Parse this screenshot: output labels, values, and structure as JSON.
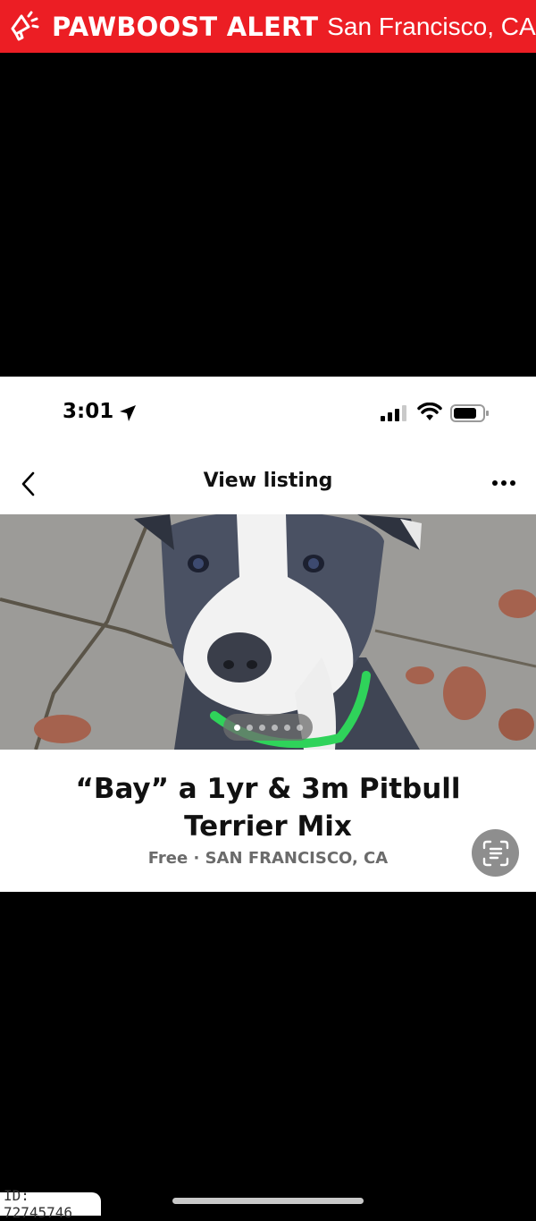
{
  "banner": {
    "brand": "PAWBOOST ALERT",
    "location": "San Francisco, CA",
    "color": "#ec1e24",
    "icon": "megaphone-icon"
  },
  "status_bar": {
    "time": "3:01",
    "icons": [
      "location-arrow-icon",
      "cellular-signal-icon",
      "wifi-icon",
      "battery-icon"
    ]
  },
  "nav": {
    "title": "View listing",
    "back_icon": "chevron-left-icon",
    "more_icon": "more-dots-icon"
  },
  "listing": {
    "photo": "gray-and-white-pitbull-with-green-collar",
    "carousel": {
      "total": 6,
      "active": 0
    },
    "title_line1": "“Bay” a 1yr & 3m Pitbull",
    "title_line2": "Terrier Mix",
    "subtitle": "Free · SAN FRANCISCO, CA",
    "scan_icon": "live-text-scan-icon"
  },
  "footer": {
    "id_label": "ID: 72745746"
  }
}
